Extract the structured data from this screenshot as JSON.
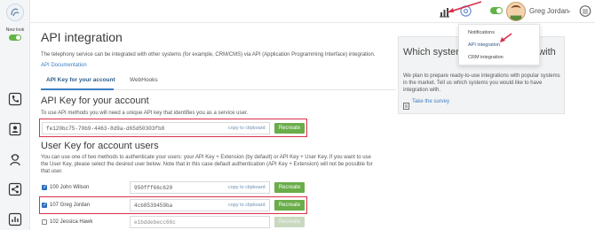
{
  "rail": {
    "new_look_label": "New look",
    "icons": [
      "phone-icon",
      "contacts-icon",
      "agent-icon",
      "integration-icon",
      "report-icon"
    ]
  },
  "topbar": {
    "user_name": "Greg Jordan"
  },
  "dropdown": {
    "items": [
      "Notifications",
      "API integration",
      "CRM integration"
    ],
    "active_index": 1
  },
  "page": {
    "title": "API integration",
    "description": "The telephony service can be integrated with other systems (for example, CRM/CMS) via API (Application Programming Interface) integration.",
    "doc_link": "API Documentation",
    "tabs": [
      "API Key for your account",
      "WebHooks"
    ],
    "active_tab": 0
  },
  "account_key": {
    "heading": "API Key for your account",
    "note": "To use API methods you will need a unique API key that identifies you as a service user.",
    "value": "fe120bc75-70b9-4463-8d9a-d65d50303fb8",
    "copy_label": "copy to clipboard",
    "button_label": "Recreate"
  },
  "user_keys": {
    "heading": "User Key for account users",
    "note_lines": [
      "You can use one of two methods to authenticate your users: your API Key + Extension (by default) or API Key + User Key. If you want to use",
      "the User Key, please select the desired user below. Note that in this case default authentication (API Key + Extension) will not be possible for",
      "that user."
    ],
    "copy_label": "copy to clipboard",
    "button_label": "Recreate",
    "rows": [
      {
        "label": "100 John Wilson",
        "key": "950fff66c620",
        "checked": true
      },
      {
        "label": "107 Greg Jordan",
        "key": "4cb8539459ba",
        "checked": true
      },
      {
        "label": "102 Jessica Hawk",
        "key": "e1bddebecc66c",
        "checked": false
      }
    ]
  },
  "panel": {
    "title": "Which system want integration with",
    "text": "We plan to prepare ready-to-use integrations with popular systems in the market. Tell us which systems you would like to have integration with.",
    "link": "Take the survey"
  },
  "colors": {
    "accent": "#3b7fc4",
    "button": "#6aad4a",
    "highlight": "#d8314b"
  }
}
